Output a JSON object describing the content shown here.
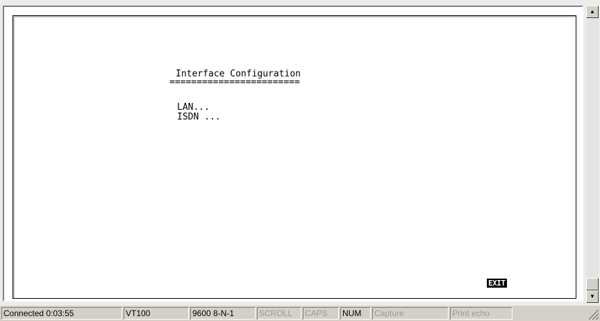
{
  "terminal": {
    "title": "Interface Configuration",
    "underline": "========================",
    "menu_items": [
      {
        "label": "LAN..."
      },
      {
        "label": "ISDN ..."
      }
    ],
    "exit_label": "EXIT"
  },
  "statusbar": {
    "connection": "Connected 0:03:55",
    "emulation": "VT100",
    "port_settings": "9600 8-N-1",
    "scroll": "SCROLL",
    "caps": "CAPS",
    "num": "NUM",
    "capture": "Capture",
    "print_echo": "Print echo"
  },
  "icons": {
    "scroll_up": "arrow-up-icon",
    "scroll_down": "arrow-down-icon"
  }
}
